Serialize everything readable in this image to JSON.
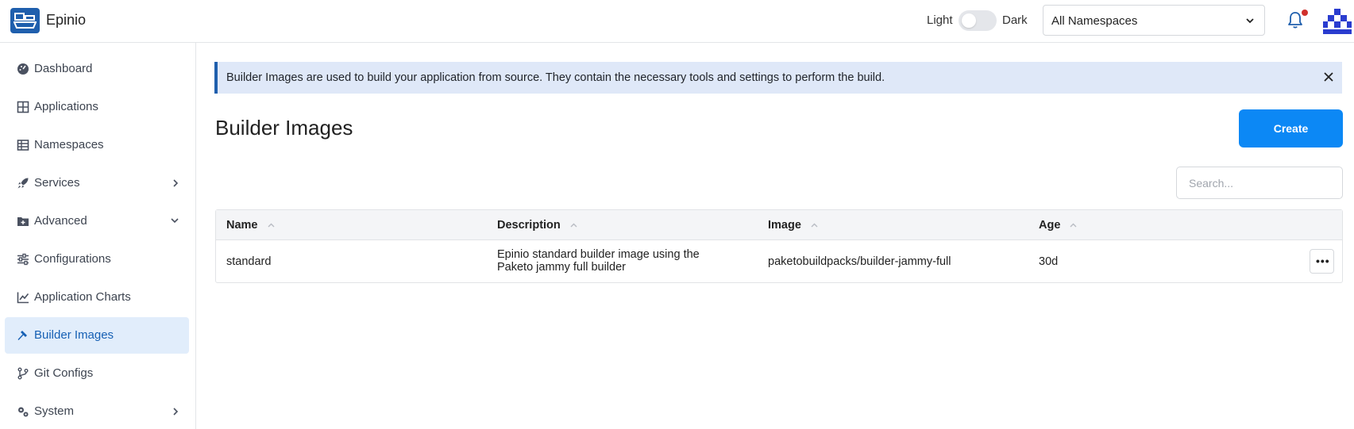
{
  "header": {
    "app_name": "Epinio",
    "theme_light": "Light",
    "theme_dark": "Dark",
    "namespace_select": "All Namespaces"
  },
  "sidebar": {
    "items": [
      {
        "label": "Dashboard",
        "icon": "dashboard-icon"
      },
      {
        "label": "Applications",
        "icon": "applications-icon"
      },
      {
        "label": "Namespaces",
        "icon": "namespaces-icon"
      },
      {
        "label": "Services",
        "icon": "rocket-icon",
        "expand": "chevron-right-icon"
      },
      {
        "label": "Advanced",
        "icon": "folder-icon",
        "expand": "chevron-down-icon"
      },
      {
        "label": "Configurations",
        "icon": "sliders-icon"
      },
      {
        "label": "Application Charts",
        "icon": "chart-icon"
      },
      {
        "label": "Builder Images",
        "icon": "hammer-icon",
        "active": true
      },
      {
        "label": "Git Configs",
        "icon": "git-branch-icon"
      },
      {
        "label": "System",
        "icon": "gears-icon",
        "expand": "chevron-right-icon"
      }
    ]
  },
  "main": {
    "banner_text": "Builder Images are used to build your application from source. They contain the necessary tools and settings to perform the build.",
    "title": "Builder Images",
    "create_label": "Create",
    "search_placeholder": "Search...",
    "table": {
      "columns": [
        "Name",
        "Description",
        "Image",
        "Age"
      ],
      "rows": [
        {
          "name": "standard",
          "description_line1": "Epinio standard builder image using the",
          "description_line2": "Paketo jammy full builder",
          "image": "paketobuildpacks/builder-jammy-full",
          "age": "30d"
        }
      ]
    }
  },
  "colors": {
    "accent": "#0c88f5",
    "brand": "#1f5fad",
    "active_bg": "#e1edfb",
    "notification": "#d0312d"
  }
}
